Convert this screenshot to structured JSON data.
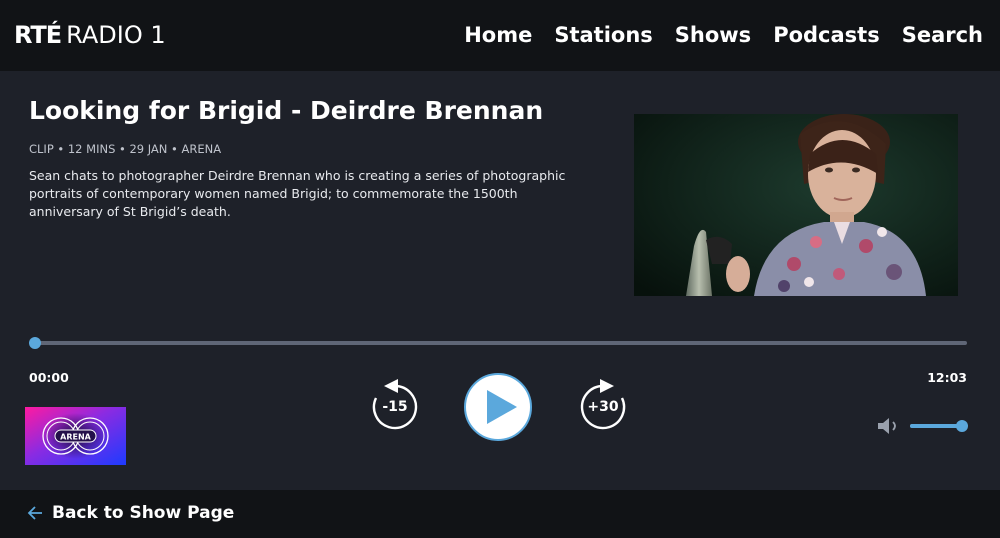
{
  "header": {
    "logo_brand": "RTÉ",
    "logo_station": "RADIO 1",
    "nav": [
      {
        "label": "Home"
      },
      {
        "label": "Stations"
      },
      {
        "label": "Shows"
      },
      {
        "label": "Podcasts"
      },
      {
        "label": "Search"
      }
    ]
  },
  "episode": {
    "title": "Looking for Brigid - Deirdre Brennan",
    "meta": "CLIP • 12 MINS • 29 JAN • ARENA",
    "description": "Sean chats to photographer Deirdre Brennan who is creating a series of photographic portraits of contemporary women named Brigid; to commemorate the 1500th anniversary of St Brigid’s death.",
    "image_icon": "portrait-photo"
  },
  "player": {
    "current_time": "00:00",
    "duration": "12:03",
    "progress_fraction": 0.0,
    "skip_back_label": "-15",
    "skip_forward_label": "+30",
    "play_icon": "play-icon",
    "volume_fraction": 1.0,
    "volume_icon": "volume-icon"
  },
  "show": {
    "logo_text": "ARENA"
  },
  "footer": {
    "back_label": "Back to Show Page",
    "back_icon": "arrow-left-icon"
  },
  "colors": {
    "accent": "#5ba8dc",
    "background": "#1e2129",
    "bar": "#111316"
  }
}
